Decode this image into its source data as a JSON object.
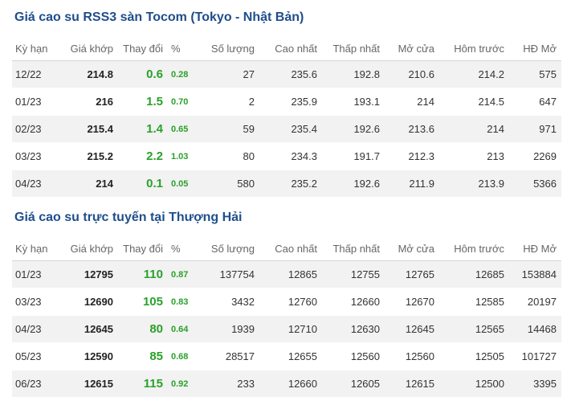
{
  "section1": {
    "title": "Giá cao su RSS3 sàn Tocom (Tokyo - Nhật Bản)",
    "headers": [
      "Kỳ hạn",
      "Giá khớp",
      "Thay đổi",
      "%",
      "Số lượng",
      "Cao nhất",
      "Thấp nhất",
      "Mở cửa",
      "Hôm trước",
      "HĐ Mở"
    ],
    "rows": [
      [
        "12/22",
        "214.8",
        "0.6",
        "0.28",
        "27",
        "235.6",
        "192.8",
        "210.6",
        "214.2",
        "575"
      ],
      [
        "01/23",
        "216",
        "1.5",
        "0.70",
        "2",
        "235.9",
        "193.1",
        "214",
        "214.5",
        "647"
      ],
      [
        "02/23",
        "215.4",
        "1.4",
        "0.65",
        "59",
        "235.4",
        "192.6",
        "213.6",
        "214",
        "971"
      ],
      [
        "03/23",
        "215.2",
        "2.2",
        "1.03",
        "80",
        "234.3",
        "191.7",
        "212.3",
        "213",
        "2269"
      ],
      [
        "04/23",
        "214",
        "0.1",
        "0.05",
        "580",
        "235.2",
        "192.6",
        "211.9",
        "213.9",
        "5366"
      ]
    ]
  },
  "section2": {
    "title": "Giá cao su trực tuyến tại Thượng Hải",
    "headers": [
      "Kỳ hạn",
      "Giá khớp",
      "Thay đổi",
      "%",
      "Số lượng",
      "Cao nhất",
      "Thấp nhất",
      "Mở cửa",
      "Hôm trước",
      "HĐ Mở"
    ],
    "rows": [
      [
        "01/23",
        "12795",
        "110",
        "0.87",
        "137754",
        "12865",
        "12755",
        "12765",
        "12685",
        "153884"
      ],
      [
        "03/23",
        "12690",
        "105",
        "0.83",
        "3432",
        "12760",
        "12660",
        "12670",
        "12585",
        "20197"
      ],
      [
        "04/23",
        "12645",
        "80",
        "0.64",
        "1939",
        "12710",
        "12630",
        "12645",
        "12565",
        "14468"
      ],
      [
        "05/23",
        "12590",
        "85",
        "0.68",
        "28517",
        "12655",
        "12560",
        "12560",
        "12505",
        "101727"
      ],
      [
        "06/23",
        "12615",
        "115",
        "0.92",
        "233",
        "12660",
        "12605",
        "12615",
        "12500",
        "3395"
      ]
    ]
  },
  "colors": {
    "title": "#1f4e8c",
    "positive": "#2aa12a",
    "row_stripe": "#f2f2f2"
  }
}
